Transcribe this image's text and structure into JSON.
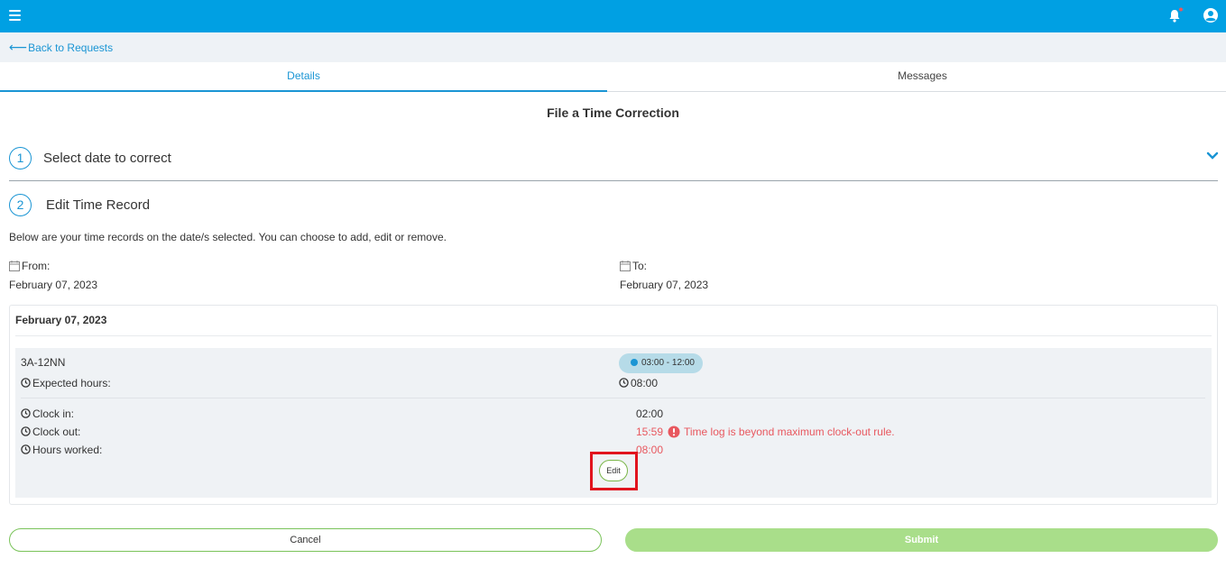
{
  "topbar": {
    "brand_color": "#00a0e3",
    "icons": [
      "menu-icon",
      "bell-icon",
      "user-icon"
    ]
  },
  "nav": {
    "back_label": "Back to Requests"
  },
  "tabs": [
    {
      "label": "Details",
      "active": true
    },
    {
      "label": "Messages",
      "active": false
    }
  ],
  "page": {
    "title": "File a Time Correction"
  },
  "steps": [
    {
      "number": "1",
      "label": "Select date to correct"
    },
    {
      "number": "2",
      "label": "Edit Time Record"
    }
  ],
  "intro": "Below are your time records on the date/s selected. You can choose to add, edit or remove.",
  "range": {
    "from_label": "From:",
    "from_value": "February 07, 2023",
    "to_label": "To:",
    "to_value": "February 07, 2023"
  },
  "record": {
    "date": "February 07, 2023",
    "schedule_name": "3A-12NN",
    "schedule_time": "03:00 - 12:00",
    "expected_label": "Expected hours:",
    "expected_value": "08:00",
    "clock_in_label": "Clock in:",
    "clock_in_value": "02:00",
    "clock_out_label": "Clock out:",
    "clock_out_value": "15:59",
    "warning": "Time log is beyond maximum clock-out rule.",
    "hours_label": "Hours worked:",
    "hours_value": "08:00",
    "edit_label": "Edit"
  },
  "actions": {
    "cancel_label": "Cancel",
    "submit_label": "Submit"
  },
  "colors": {
    "accent": "#1a95d4",
    "error": "#e8585f",
    "success": "#7ab648",
    "submit_disabled": "#a9de8a",
    "highlight": "#e1141e"
  }
}
